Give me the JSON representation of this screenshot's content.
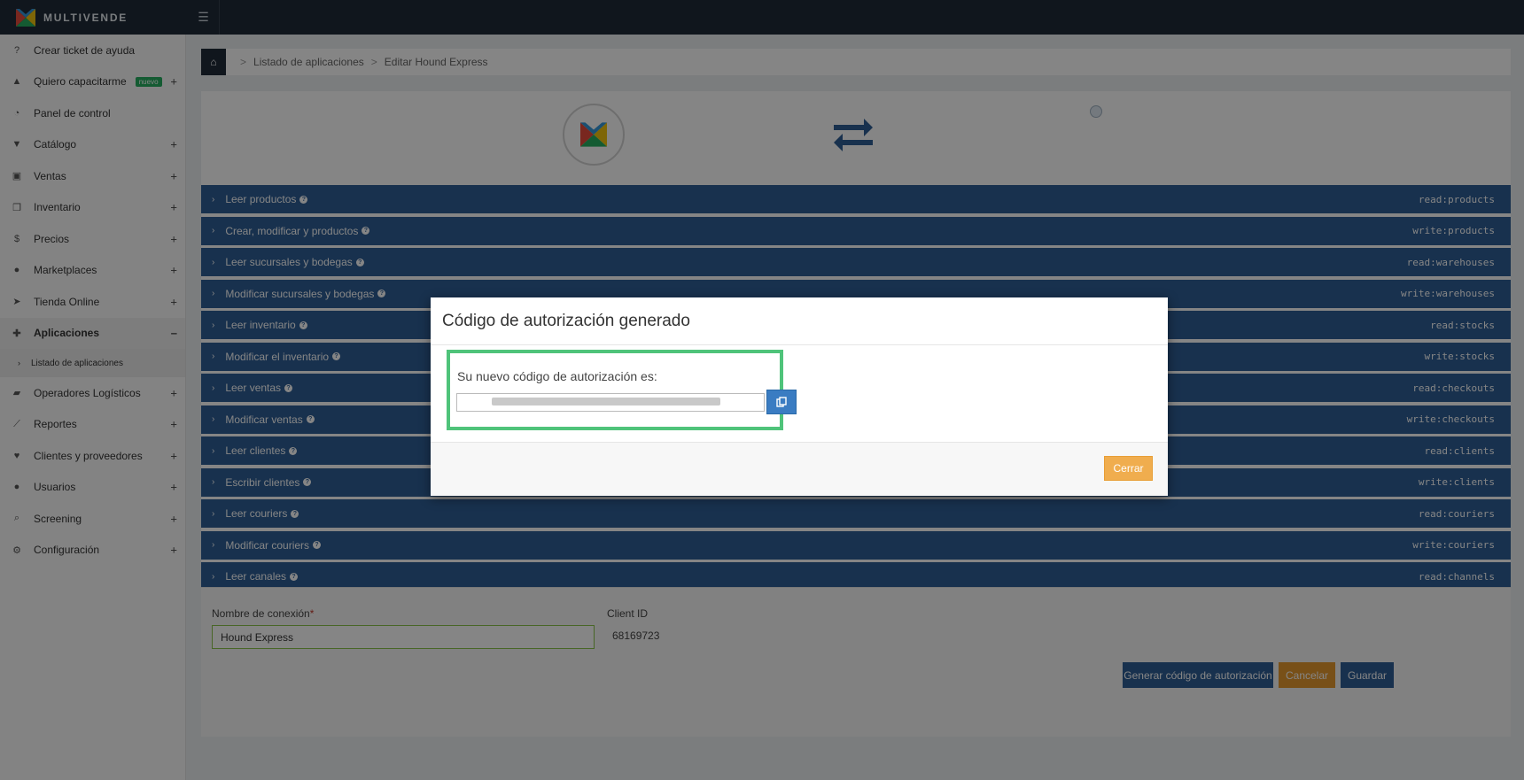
{
  "brand": {
    "name": "MULTIVENDE"
  },
  "sidebar": {
    "items": [
      {
        "label": "Crear ticket de ayuda",
        "icon": "question-circle-icon",
        "glyph": "?",
        "plus": ""
      },
      {
        "label": "Quiero capacitarme",
        "icon": "graduation-cap-icon",
        "glyph": "🎓",
        "plus": "+",
        "badge": "nuevo"
      },
      {
        "label": "Panel de control",
        "icon": "dashboard-icon",
        "glyph": "◔",
        "plus": ""
      },
      {
        "label": "Catálogo",
        "icon": "cart-icon",
        "glyph": "🛒",
        "plus": "+"
      },
      {
        "label": "Ventas",
        "icon": "money-icon",
        "glyph": "▣",
        "plus": "+"
      },
      {
        "label": "Inventario",
        "icon": "cubes-icon",
        "glyph": "❒",
        "plus": "+"
      },
      {
        "label": "Precios",
        "icon": "dollar-icon",
        "glyph": "$",
        "plus": "+"
      },
      {
        "label": "Marketplaces",
        "icon": "globe-icon",
        "glyph": "●",
        "plus": "+"
      },
      {
        "label": "Tienda Online",
        "icon": "pointer-icon",
        "glyph": "➤",
        "plus": "+"
      },
      {
        "label": "Aplicaciones",
        "icon": "puzzle-icon",
        "glyph": "✚",
        "plus": "–"
      },
      {
        "label": "Operadores Logísticos",
        "icon": "truck-icon",
        "glyph": "▰",
        "plus": "+"
      },
      {
        "label": "Reportes",
        "icon": "line-chart-icon",
        "glyph": "⟋",
        "plus": "+"
      },
      {
        "label": "Clientes y proveedores",
        "icon": "heart-icon",
        "glyph": "♥",
        "plus": "+"
      },
      {
        "label": "Usuarios",
        "icon": "user-icon",
        "glyph": "●",
        "plus": "+"
      },
      {
        "label": "Screening",
        "icon": "search-icon",
        "glyph": "⌕",
        "plus": "+"
      },
      {
        "label": "Configuración",
        "icon": "gear-icon",
        "glyph": "⚙",
        "plus": "+"
      }
    ],
    "sub_item": "Listado de aplicaciones"
  },
  "breadcrumb": {
    "items": [
      "Listado de aplicaciones",
      "Editar Hound Express"
    ],
    "separator": ">"
  },
  "permissions": [
    {
      "label": "Leer productos",
      "scope": "read:products"
    },
    {
      "label": "Crear, modificar y productos",
      "scope": "write:products"
    },
    {
      "label": "Leer sucursales y bodegas",
      "scope": "read:warehouses"
    },
    {
      "label": "Modificar sucursales y bodegas",
      "scope": "write:warehouses"
    },
    {
      "label": "Leer inventario",
      "scope": "read:stocks"
    },
    {
      "label": "Modificar el inventario",
      "scope": "write:stocks"
    },
    {
      "label": "Leer ventas",
      "scope": "read:checkouts"
    },
    {
      "label": "Modificar ventas",
      "scope": "write:checkouts"
    },
    {
      "label": "Leer clientes",
      "scope": "read:clients"
    },
    {
      "label": "Escribir clientes",
      "scope": "write:clients"
    },
    {
      "label": "Leer couriers",
      "scope": "read:couriers"
    },
    {
      "label": "Modificar couriers",
      "scope": "write:couriers"
    },
    {
      "label": "Leer canales",
      "scope": "read:channels"
    }
  ],
  "form": {
    "connection_label": "Nombre de conexión",
    "required_mark": "*",
    "connection_value": "Hound Express",
    "client_id_label": "Client ID",
    "client_id_value": "68169723",
    "generate_btn": "Generar código de autorización",
    "cancel_btn": "Cancelar",
    "save_btn": "Guardar"
  },
  "modal": {
    "title": "Código de autorización generado",
    "code_label": "Su nuevo código de autorización es:",
    "close_btn": "Cerrar"
  },
  "colors": {
    "topbar": "#1f2b38",
    "permission_row": "#2f5f96",
    "highlight": "#4fc37a",
    "warning": "#f0ad4e"
  }
}
